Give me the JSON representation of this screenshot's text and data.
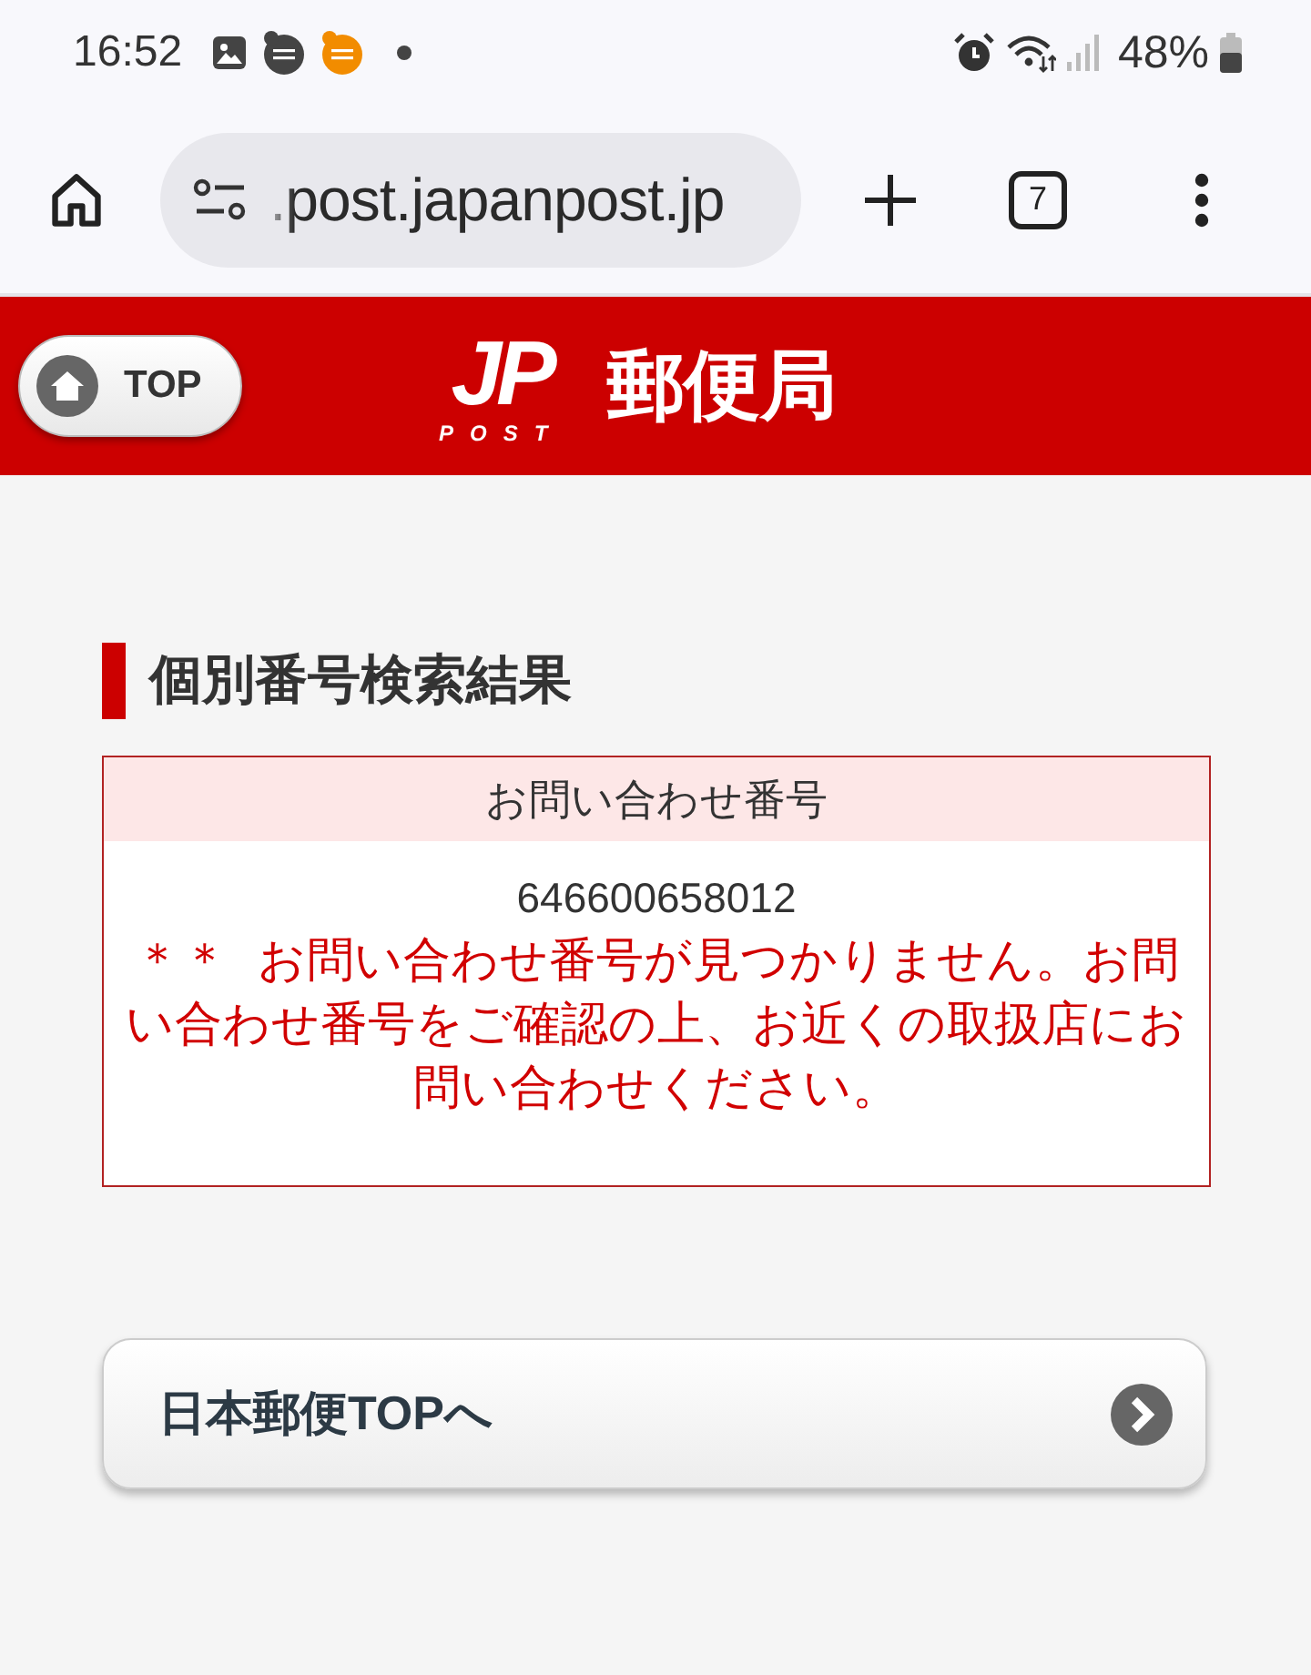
{
  "status_bar": {
    "time": "16:52",
    "battery": "48%"
  },
  "browser": {
    "url": ".post.japanpost.jp",
    "tab_count": "7"
  },
  "header": {
    "top_button": "TOP",
    "logo": {
      "mark": "JP",
      "sub": "POST"
    },
    "title": "郵便局"
  },
  "section": {
    "heading": "個別番号検索結果"
  },
  "result_table": {
    "header": "お問い合わせ番号",
    "number": "646600658012",
    "message": "＊＊ お問い合わせ番号が見つかりません。お問い合わせ番号をご確認の上、お近くの取扱店にお問い合わせください。"
  },
  "nav_button": {
    "label": "日本郵便TOPへ"
  }
}
